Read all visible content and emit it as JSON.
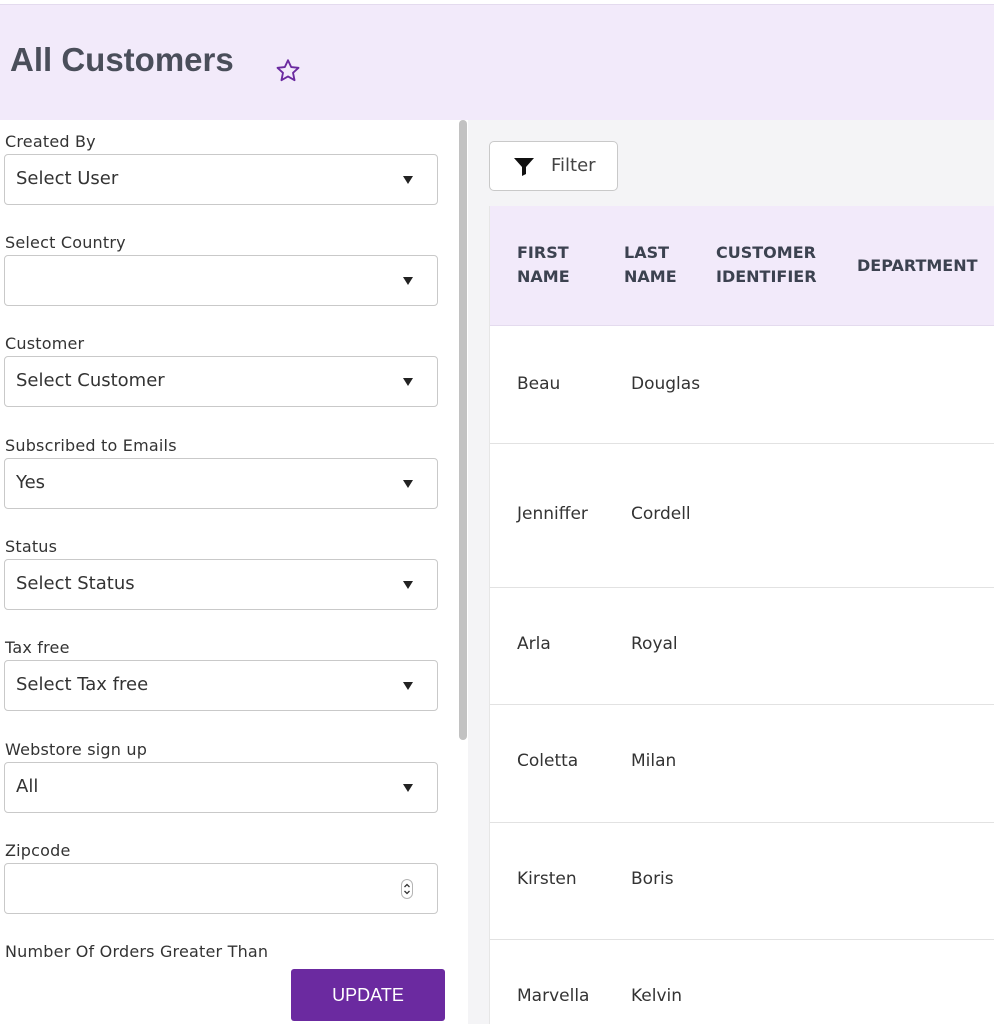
{
  "header": {
    "title": "All Customers",
    "favorite_icon": "star-outline-icon",
    "accent": "#6b2aa0"
  },
  "filters": {
    "created_by": {
      "label": "Created By",
      "value": "Select User"
    },
    "country": {
      "label": "Select Country",
      "value": ""
    },
    "customer": {
      "label": "Customer",
      "value": "Select Customer"
    },
    "subscribed": {
      "label": "Subscribed to Emails",
      "value": "Yes"
    },
    "status": {
      "label": "Status",
      "value": "Select Status"
    },
    "tax_free": {
      "label": "Tax free",
      "value": "Select Tax free"
    },
    "webstore": {
      "label": "Webstore sign up",
      "value": "All"
    },
    "zipcode": {
      "label": "Zipcode",
      "value": ""
    },
    "orders_gt": {
      "label": "Number Of Orders Greater Than"
    },
    "update_label": "UPDATE"
  },
  "toolbar": {
    "filter_label": "Filter"
  },
  "table": {
    "columns": [
      {
        "line1": "FIRST",
        "line2": "NAME"
      },
      {
        "line1": "LAST",
        "line2": "NAME"
      },
      {
        "line1": "CUSTOMER",
        "line2": "IDENTIFIER"
      },
      {
        "line1": "DEPARTMENT",
        "line2": ""
      }
    ],
    "rows": [
      {
        "first": "Beau",
        "last": "Douglas"
      },
      {
        "first": "Jenniffer",
        "last": "Cordell"
      },
      {
        "first": "Arla",
        "last": "Royal"
      },
      {
        "first": "Coletta",
        "last": "Milan"
      },
      {
        "first": "Kirsten",
        "last": "Boris"
      },
      {
        "first": "Marvella",
        "last": "Kelvin"
      }
    ]
  }
}
